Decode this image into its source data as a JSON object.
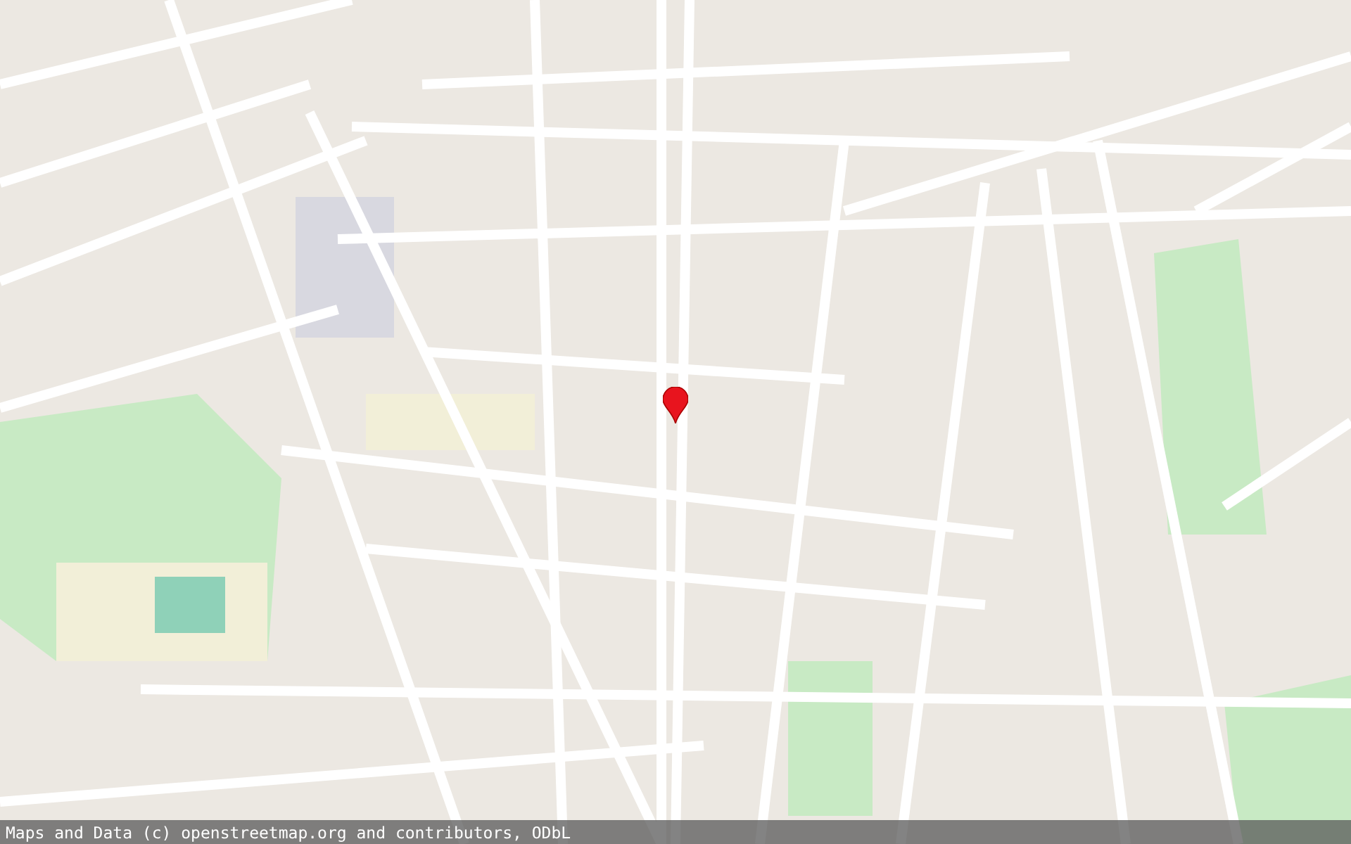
{
  "map": {
    "attribution": "Maps and Data (c) openstreetmap.org and contributors, ODbL"
  }
}
